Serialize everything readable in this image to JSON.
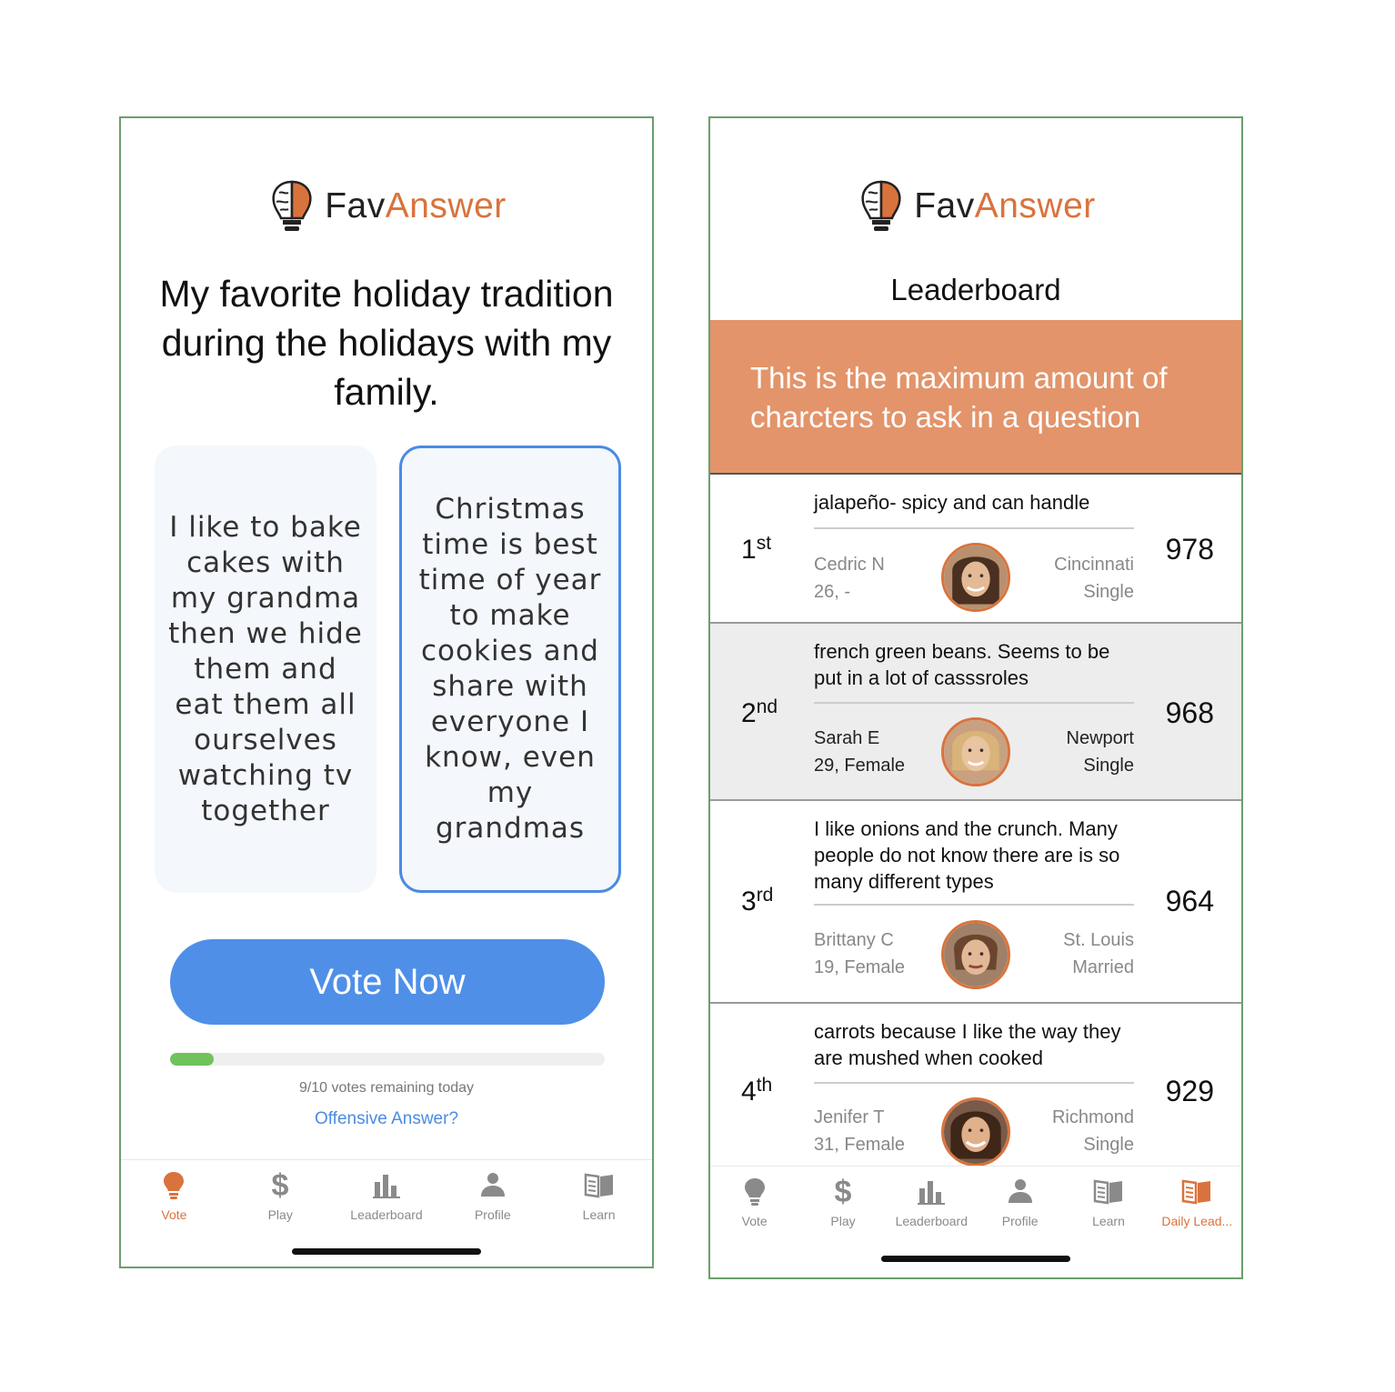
{
  "app": {
    "logo_fav": "Fav",
    "logo_answer": "Answer"
  },
  "colors": {
    "accent": "#d9733d",
    "primary": "#4f8fe8",
    "progress": "#6fc35b",
    "banner": "#e3946a"
  },
  "vote_screen": {
    "question": "My favorite holiday tradition during the holidays with my family.",
    "answers": [
      {
        "text": "I like to bake cakes with my grandma then we hide them and eat them all ourselves watching tv together",
        "selected": false
      },
      {
        "text": "Christmas time is best time of year to make cookies and share with everyone I know, even my grandmas",
        "selected": true
      }
    ],
    "vote_button": "Vote Now",
    "progress_fraction": 0.1,
    "votes_remaining": "9/10 votes remaining today",
    "offensive_link": "Offensive Answer?",
    "tabs": [
      {
        "label": "Vote",
        "icon": "lightbulb-icon",
        "active": true
      },
      {
        "label": "Play",
        "icon": "dollar-icon",
        "active": false
      },
      {
        "label": "Leaderboard",
        "icon": "bar-chart-icon",
        "active": false
      },
      {
        "label": "Profile",
        "icon": "person-icon",
        "active": false
      },
      {
        "label": "Learn",
        "icon": "book-icon",
        "active": false
      }
    ]
  },
  "leaderboard_screen": {
    "title": "Leaderboard",
    "banner": "This is the maximum amount of charcters to ask in a question",
    "entries": [
      {
        "rank_num": "1",
        "rank_suffix": "st",
        "answer": "jalapeño- spicy and can handle",
        "name": "Cedric N",
        "details": "26, -",
        "city": "Cincinnati",
        "status": "Single",
        "score": "978"
      },
      {
        "rank_num": "2",
        "rank_suffix": "nd",
        "answer": "french green beans. Seems to be put in a lot of casssroles",
        "name": "Sarah E",
        "details": "29, Female",
        "city": "Newport",
        "status": "Single",
        "score": "968"
      },
      {
        "rank_num": "3",
        "rank_suffix": "rd",
        "answer": "I like onions and the crunch. Many people do not know there are is so many different types",
        "name": "Brittany C",
        "details": "19, Female",
        "city": "St. Louis",
        "status": "Married",
        "score": "964"
      },
      {
        "rank_num": "4",
        "rank_suffix": "th",
        "answer": "carrots because I like the way they are mushed when cooked",
        "name": "Jenifer T",
        "details": "31, Female",
        "city": "Richmond",
        "status": "Single",
        "score": "929"
      }
    ],
    "tabs": [
      {
        "label": "Vote",
        "icon": "lightbulb-icon",
        "active": false
      },
      {
        "label": "Play",
        "icon": "dollar-icon",
        "active": false
      },
      {
        "label": "Leaderboard",
        "icon": "bar-chart-icon",
        "active": false
      },
      {
        "label": "Profile",
        "icon": "person-icon",
        "active": false
      },
      {
        "label": "Learn",
        "icon": "book-icon",
        "active": false
      },
      {
        "label": "Daily Lead...",
        "icon": "book-open-icon",
        "active": true
      }
    ]
  }
}
